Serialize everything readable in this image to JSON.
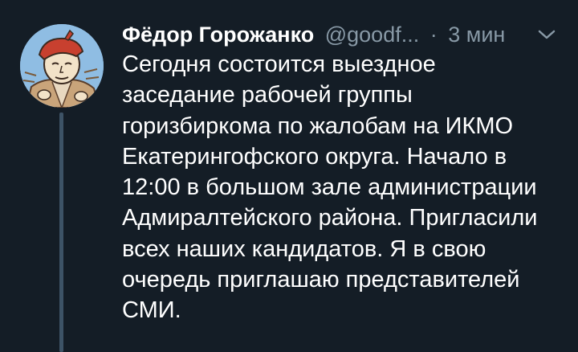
{
  "tweet": {
    "author": {
      "display_name": "Фёдор Горожанко",
      "handle": "@goodf...",
      "avatar_icon": "avatar-illustration"
    },
    "separator": "·",
    "timestamp": "3 мин",
    "menu_icon": "chevron-down-icon",
    "text_lines": [
      "Сегодня состоится выездное",
      "заседание рабочей группы",
      "горизбиркома по жалобам на ИКМО",
      "Екатерингофского округа. Начало в",
      "12:00 в большом зале администрации",
      "Адмиралтейского района. Пригласили",
      "всех наших кандидатов. Я в свою",
      "очередь приглашаю представителей",
      "СМИ."
    ]
  },
  "colors": {
    "background": "#141d26",
    "text": "#ffffff",
    "secondary_text": "#8899a6",
    "thread_line": "#3d5366"
  }
}
